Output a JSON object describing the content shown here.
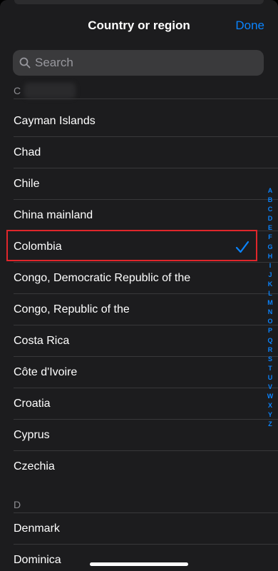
{
  "nav": {
    "title": "Country or region",
    "done_label": "Done"
  },
  "search": {
    "placeholder": "Search"
  },
  "sections": [
    {
      "header": "C"
    },
    {
      "header": "D"
    }
  ],
  "countries": [
    "Cayman Islands",
    "Chad",
    "Chile",
    "China mainland",
    "Colombia",
    "Congo, Democratic Republic of the",
    "Congo, Republic of the",
    "Costa Rica",
    "Côte d'Ivoire",
    "Croatia",
    "Cyprus",
    "Czechia",
    "Denmark",
    "Dominica"
  ],
  "selected_country": "Colombia",
  "index_letters": [
    "A",
    "B",
    "C",
    "D",
    "E",
    "F",
    "G",
    "H",
    "I",
    "J",
    "K",
    "L",
    "M",
    "N",
    "O",
    "P",
    "Q",
    "R",
    "S",
    "T",
    "U",
    "V",
    "W",
    "X",
    "Y",
    "Z"
  ],
  "colors": {
    "accent": "#0a84ff",
    "highlight_border": "#e0262b",
    "background": "#1c1c1e"
  }
}
